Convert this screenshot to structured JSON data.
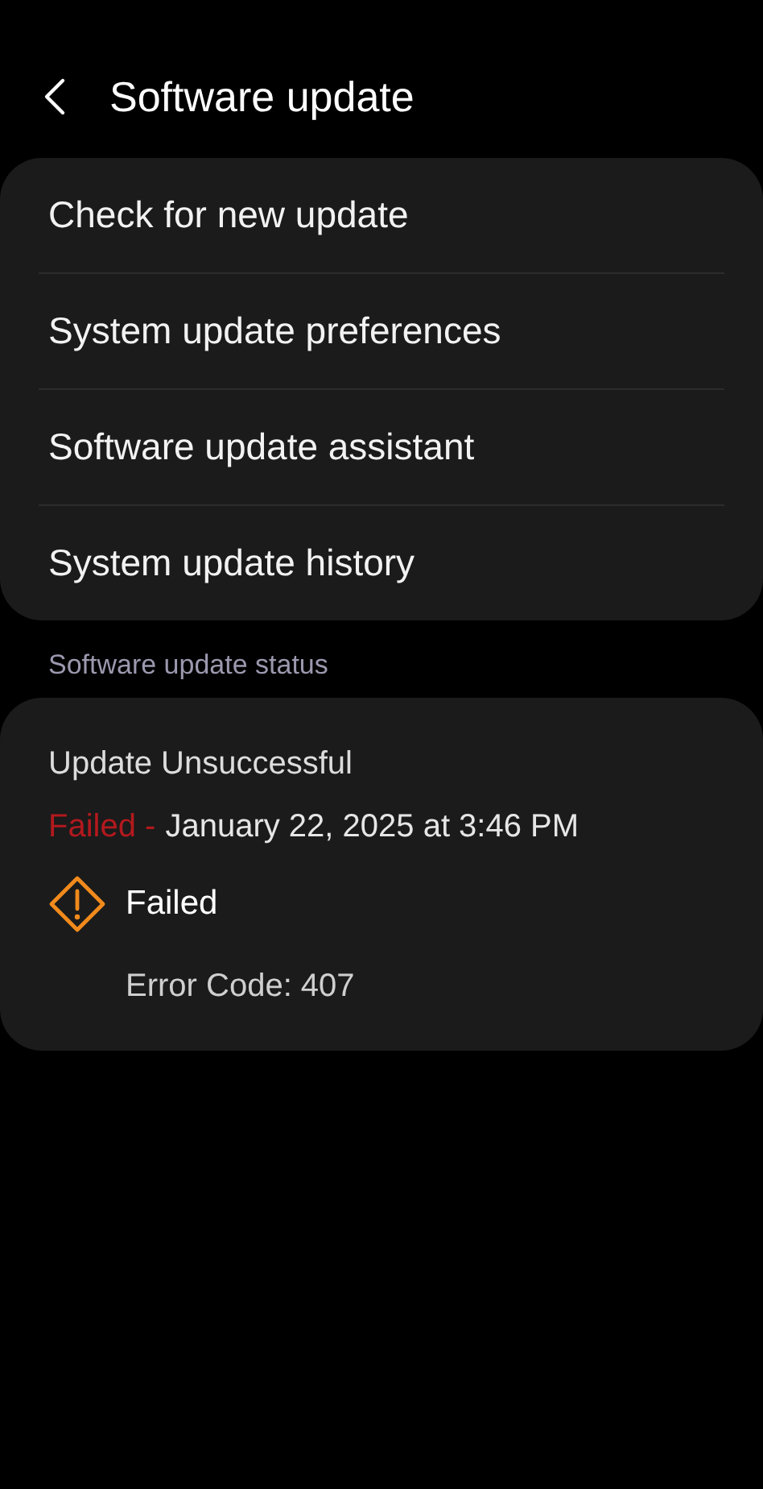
{
  "header": {
    "title": "Software update"
  },
  "menu": [
    {
      "label": "Check for new update"
    },
    {
      "label": "System update preferences"
    },
    {
      "label": "Software update assistant"
    },
    {
      "label": "System update history"
    }
  ],
  "section_label": "Software update status",
  "status": {
    "title": "Update Unsuccessful",
    "result": "Failed -",
    "date": "January 22, 2025 at 3:46 PM",
    "message": "Failed",
    "detail": "Error Code: 407"
  }
}
